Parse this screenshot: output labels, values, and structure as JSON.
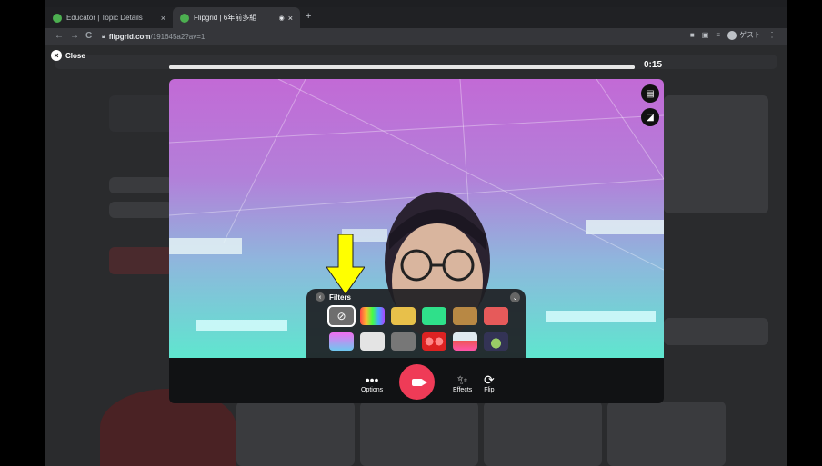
{
  "tabs": [
    {
      "title": "Educator | Topic Details",
      "close": "×"
    },
    {
      "title": "Flipgrid | 6年前多組",
      "close": "×"
    }
  ],
  "new_tab": "+",
  "address": {
    "domain": "flipgrid.com",
    "path": "/191645a2?av=1"
  },
  "profile_label": "ゲスト",
  "close_label": "Close",
  "timer": "0:15",
  "progress": 1.0,
  "filters": {
    "title": "Filters",
    "swatches_row1": [
      "#6e6e6e",
      "#rainbow",
      "#e8c04a",
      "#2fe08a",
      "#b88844",
      "#e65a5a"
    ],
    "swatches_row2": [
      "#b978f0",
      "#e4e4e4",
      "#777777",
      "#e04040",
      "#photo",
      "#alien"
    ]
  },
  "toolbar": {
    "options_label": "Options",
    "effects_label": "Effects",
    "flip_label": "Flip"
  },
  "colors": {
    "record": "#ef3b57",
    "arrow": "#ffff00"
  }
}
